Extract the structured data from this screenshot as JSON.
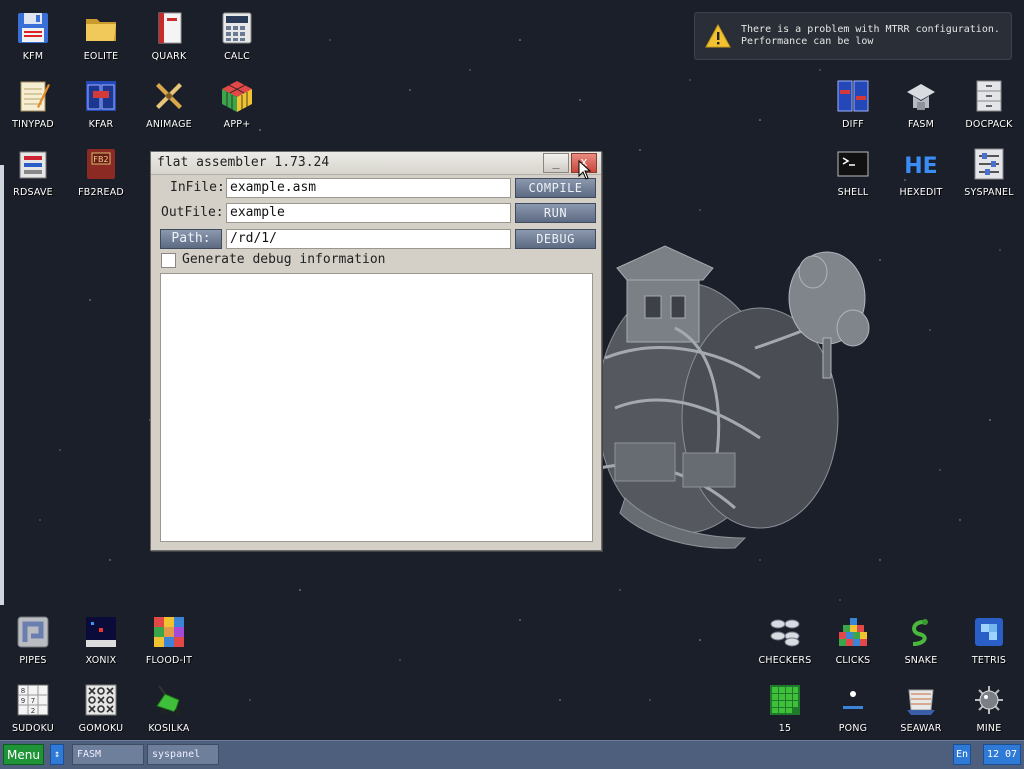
{
  "desktop": {
    "icons_top_left": [
      {
        "label": "KFM",
        "icon": "floppy-disk-icon"
      },
      {
        "label": "EOLITE",
        "icon": "folder-icon"
      },
      {
        "label": "QUARK",
        "icon": "book-icon"
      },
      {
        "label": "CALC",
        "icon": "calculator-icon"
      },
      {
        "label": "TINYPAD",
        "icon": "notepad-icon"
      },
      {
        "label": "KFAR",
        "icon": "file-manager-icon"
      },
      {
        "label": "ANIMAGE",
        "icon": "paint-tools-icon"
      },
      {
        "label": "APP+",
        "icon": "cube-icon"
      },
      {
        "label": "RDSAVE",
        "icon": "disk-save-icon"
      },
      {
        "label": "FB2READ",
        "icon": "fb2-book-icon"
      }
    ],
    "icons_top_right": [
      {
        "label": "DIFF",
        "icon": "diff-icon"
      },
      {
        "label": "FASM",
        "icon": "fasm-icon"
      },
      {
        "label": "DOCPACK",
        "icon": "cabinet-icon"
      },
      {
        "label": "SHELL",
        "icon": "terminal-icon"
      },
      {
        "label": "HEXEDIT",
        "icon": "hex-icon"
      },
      {
        "label": "SYSPANEL",
        "icon": "sliders-icon"
      }
    ],
    "icons_bottom_left": [
      {
        "label": "PIPES",
        "icon": "pipes-icon"
      },
      {
        "label": "XONIX",
        "icon": "xonix-icon"
      },
      {
        "label": "FLOOD-IT",
        "icon": "color-grid-icon"
      },
      {
        "label": "SUDOKU",
        "icon": "sudoku-icon"
      },
      {
        "label": "GOMOKU",
        "icon": "gomoku-icon"
      },
      {
        "label": "KOSILKA",
        "icon": "lawnmower-icon"
      }
    ],
    "icons_bottom_right": [
      {
        "label": "CHECKERS",
        "icon": "checkers-icon"
      },
      {
        "label": "CLICKS",
        "icon": "blocks-icon"
      },
      {
        "label": "SNAKE",
        "icon": "snake-icon"
      },
      {
        "label": "TETRIS",
        "icon": "tetris-icon"
      },
      {
        "label": "15",
        "icon": "fifteen-puzzle-icon"
      },
      {
        "label": "PONG",
        "icon": "pong-icon"
      },
      {
        "label": "SEAWAR",
        "icon": "ship-icon"
      },
      {
        "label": "MINE",
        "icon": "mine-icon"
      }
    ]
  },
  "notification": {
    "line1": "There is a problem with MTRR configuration.",
    "line2": "Performance can be low"
  },
  "window": {
    "title": "flat assembler 1.73.24",
    "minimize_label": "_",
    "close_label": "x",
    "infile_label": "InFile:",
    "infile_value": "example.asm",
    "outfile_label": "OutFile:",
    "outfile_value": "example",
    "path_button": "Path:",
    "path_value": "/rd/1/",
    "compile_button": "COMPILE",
    "run_button": "RUN",
    "debug_button": "DEBUG",
    "debug_info_label": "Generate debug information",
    "debug_info_checked": false,
    "output_text": ""
  },
  "taskbar": {
    "menu_label": "Menu",
    "up_label": "↕",
    "tasks": [
      "FASM",
      "syspanel"
    ],
    "language": "En",
    "clock": "12 07"
  }
}
